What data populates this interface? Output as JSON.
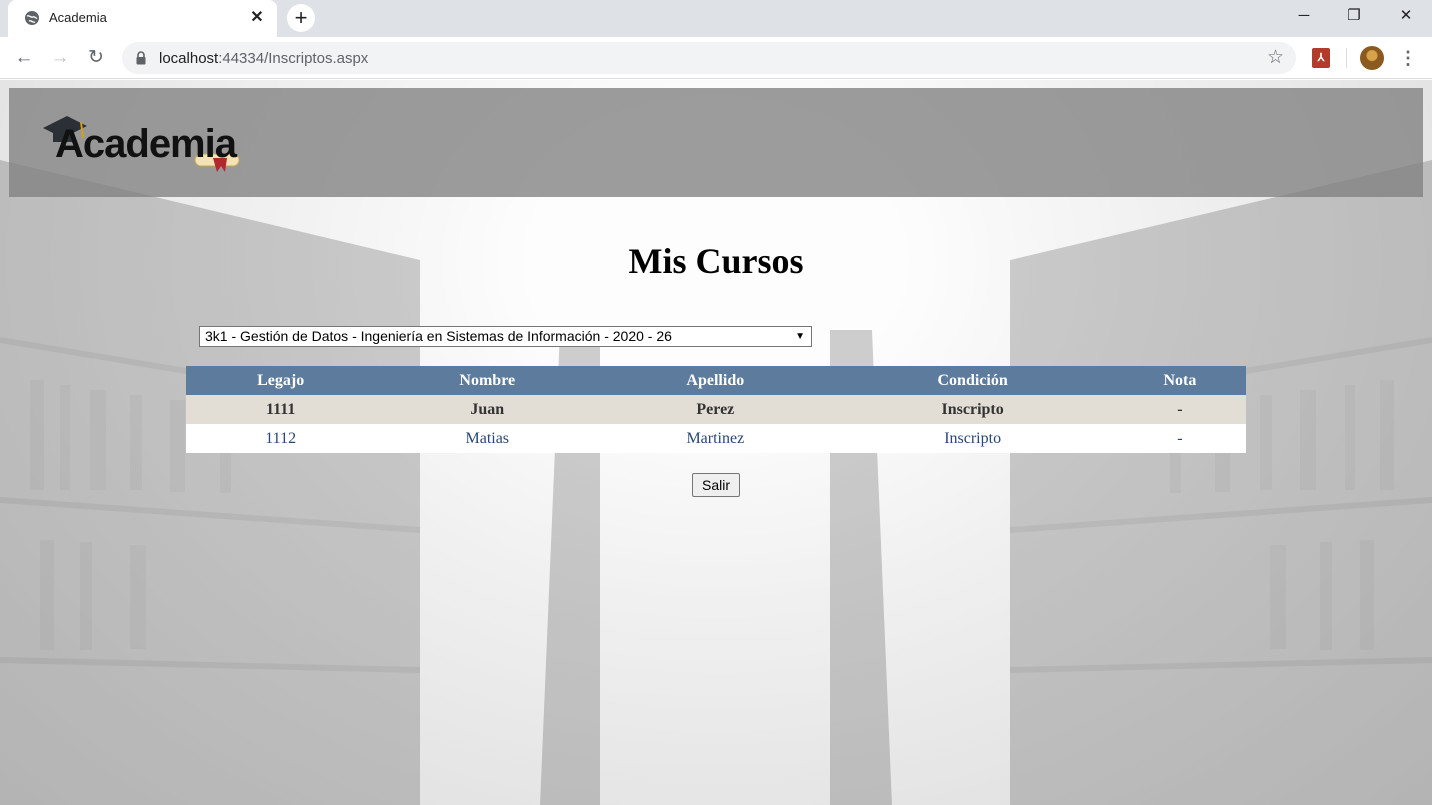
{
  "browser": {
    "tab_title": "Academia",
    "tab_close": "✕",
    "new_tab": "+",
    "url_host": "localhost",
    "url_rest": ":44334/Inscriptos.aspx",
    "window_controls": {
      "minimize": "─",
      "restore": "❐",
      "close": "✕"
    },
    "nav": {
      "back": "←",
      "forward": "→",
      "reload": "↻"
    },
    "star": "☆",
    "kebab": "⋮",
    "icons": [
      "globe-icon",
      "lock-icon",
      "star-icon",
      "pdf-extension-icon",
      "profile-avatar",
      "menu-kebab-icon"
    ]
  },
  "header": {
    "logo_text": "Academia"
  },
  "main": {
    "title": "Mis Cursos",
    "course_select": {
      "selected": "3k1 - Gestión de Datos - Ingeniería en Sistemas de Información - 2020 - 26",
      "arrow": "▼"
    },
    "table": {
      "columns": [
        "Legajo",
        "Nombre",
        "Apellido",
        "Condición",
        "Nota"
      ],
      "rows": [
        [
          "1111",
          "Juan",
          "Perez",
          "Inscripto",
          "-"
        ],
        [
          "1112",
          "Matias",
          "Martinez",
          "Inscripto",
          "-"
        ]
      ]
    },
    "exit_button": "Salir"
  },
  "colors": {
    "header_bg": "#808080",
    "grid_header": "#5d7b9d",
    "row_alt": "#e2ded6",
    "row_text": "#284775"
  }
}
